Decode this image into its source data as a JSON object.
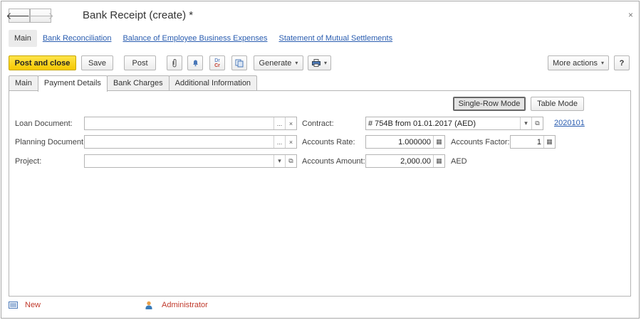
{
  "window": {
    "title": "Bank Receipt (create) *",
    "close_glyph": "×",
    "back_glyph": "🡐",
    "forward_glyph": "🡒"
  },
  "section_tabs": [
    {
      "label": "Main",
      "active": true
    },
    {
      "label": "Bank Reconciliation"
    },
    {
      "label": "Balance of Employee Business Expenses"
    },
    {
      "label": "Statement of Mutual Settlements"
    }
  ],
  "toolbar": {
    "post_and_close": "Post and close",
    "save": "Save",
    "post": "Post",
    "generate": "Generate",
    "more_actions": "More actions",
    "help": "?",
    "icons": [
      "paperclip-icon",
      "bell-icon",
      "dr-cr-icon",
      "copy-icon",
      "print-icon"
    ],
    "drcr_dr": "Dr",
    "drcr_cr": "Cr",
    "caret": "▾"
  },
  "form_tabs": [
    {
      "label": "Main"
    },
    {
      "label": "Payment Details",
      "active": true
    },
    {
      "label": "Bank Charges"
    },
    {
      "label": "Additional Information"
    }
  ],
  "mode_buttons": {
    "single_row": "Single-Row Mode",
    "table": "Table Mode"
  },
  "fields": {
    "loan_document": {
      "label": "Loan Document:",
      "value": ""
    },
    "planning_document": {
      "label": "Planning Document:",
      "value": ""
    },
    "project": {
      "label": "Project:",
      "value": ""
    },
    "contract": {
      "label": "Contract:",
      "value": "# 754B from 01.01.2017 (AED)",
      "link": "2020101"
    },
    "accounts_rate": {
      "label": "Accounts Rate:",
      "value": "1.000000"
    },
    "accounts_factor": {
      "label": "Accounts Factor:",
      "value": "1"
    },
    "accounts_amount": {
      "label": "Accounts Amount:",
      "value": "2,000.00",
      "currency": "AED"
    }
  },
  "field_buttons": {
    "ellipsis": "...",
    "clear": "×",
    "dropdown": "▾",
    "open": "⧉",
    "calc": "▦"
  },
  "footer": {
    "new": "New",
    "user": "Administrator"
  },
  "colors": {
    "primary_button": "#f5c800",
    "link": "#2a5db0",
    "footer_text": "#c0392b"
  }
}
